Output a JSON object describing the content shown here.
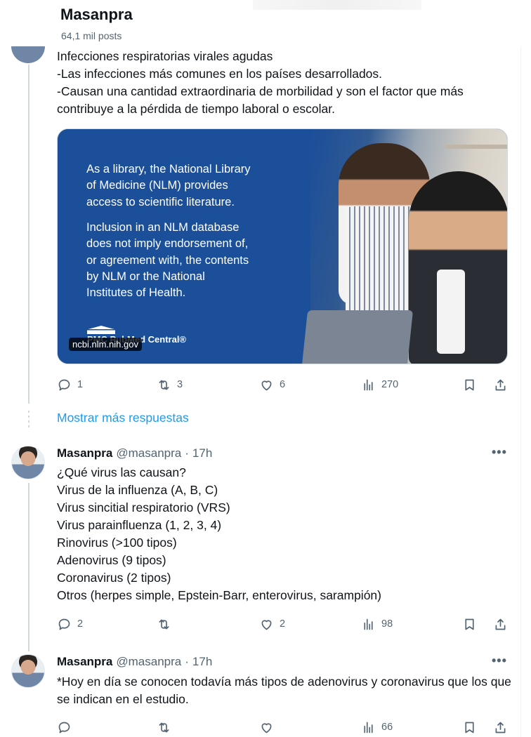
{
  "header": {
    "title": "Masanpra",
    "subtitle": "64,1 mil posts"
  },
  "tweet1": {
    "text": "Infecciones respiratorias virales agudas\n-Las infecciones más comunes en los países desarrollados.\n-Causan una cantidad extraordinaria de morbilidad y son el factor que más contribuye a la pérdida de tiempo laboral o escolar.",
    "card": {
      "copy1": "As a library, the National Library\nof Medicine (NLM) provides\naccess to scientific literature.",
      "copy2": "Inclusion in an NLM database\ndoes not imply endorsement of,\nor agreement with, the contents\nby NLM or the National\nInstitutes of Health.",
      "logo_text": "PMC PubMed Central®",
      "domain": "ncbi.nlm.nih.gov"
    },
    "actions": {
      "replies": "1",
      "reposts": "3",
      "likes": "6",
      "views": "270"
    }
  },
  "show_more_replies": "Mostrar más respuestas",
  "tweet2": {
    "name": "Masanpra",
    "handle": "@masanpra",
    "separator": "·",
    "time": "17h",
    "text": "¿Qué virus las causan?\nVirus de la influenza (A, B, C)\nVirus sincitial respiratorio (VRS)\nVirus parainfluenza (1, 2, 3, 4)\nRinovirus (>100 tipos)\nAdenovirus (9 tipos)\nCoronavirus (2 tipos)\nOtros (herpes simple, Epstein-Barr, enterovirus, sarampión)",
    "actions": {
      "replies": "2",
      "reposts": "",
      "likes": "2",
      "views": "98"
    }
  },
  "tweet3": {
    "name": "Masanpra",
    "handle": "@masanpra",
    "separator": "·",
    "time": "17h",
    "text": "*Hoy en día se conocen todavía más tipos de adenovirus y coronavirus que los que se indican en el estudio.",
    "actions": {
      "replies": "",
      "reposts": "",
      "likes": "",
      "views": "66"
    }
  },
  "more_menu_glyph": "•••",
  "colors": {
    "link": "#1d9bf0",
    "text": "#0f1419",
    "muted": "#536471",
    "thread_line": "#cfd9de",
    "card_blue": "#1b4f9a"
  },
  "icons": [
    "reply-icon",
    "repost-icon",
    "like-icon",
    "views-icon",
    "bookmark-icon",
    "share-icon",
    "more-icon"
  ]
}
